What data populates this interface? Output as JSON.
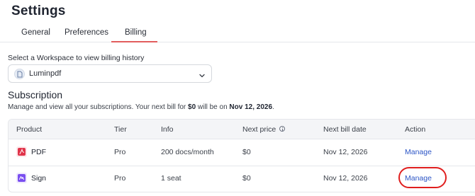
{
  "page": {
    "title": "Settings"
  },
  "tabs": [
    {
      "label": "General"
    },
    {
      "label": "Preferences"
    },
    {
      "label": "Billing",
      "active": true
    }
  ],
  "workspace": {
    "label": "Select a Workspace to view billing history",
    "selected": "Luminpdf"
  },
  "subscription": {
    "title": "Subscription",
    "desc_prefix": "Manage and view all your subscriptions. Your next bill for ",
    "amount": "$0",
    "desc_mid": " will be on ",
    "date": "Nov 12, 2026",
    "desc_suffix": "."
  },
  "table": {
    "headers": {
      "product": "Product",
      "tier": "Tier",
      "info": "Info",
      "next_price": "Next price",
      "next_bill_date": "Next bill date",
      "action": "Action"
    },
    "rows": [
      {
        "product": "PDF",
        "tier": "Pro",
        "info": "200 docs/month",
        "next_price": "$0",
        "next_bill_date": "Nov 12, 2026",
        "action": "Manage",
        "icon": "pdf-icon",
        "icon_color": "#e0344a"
      },
      {
        "product": "Sign",
        "tier": "Pro",
        "info": "1 seat",
        "next_price": "$0",
        "next_bill_date": "Nov 12, 2026",
        "action": "Manage",
        "icon": "sign-icon",
        "icon_color": "#7a4ff0"
      }
    ]
  },
  "colors": {
    "accent": "#e25d5d",
    "link": "#2c55c6",
    "highlight": "#e01e1e"
  }
}
